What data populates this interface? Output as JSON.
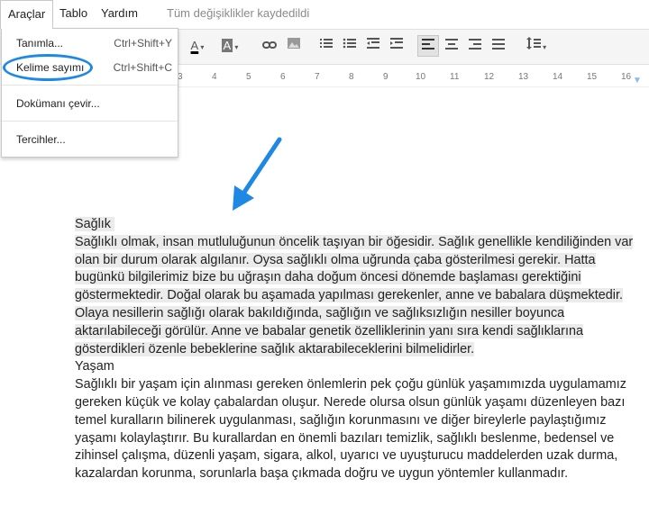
{
  "menubar": {
    "items": [
      "Araçlar",
      "Tablo",
      "Yardım"
    ],
    "status": "Tüm değişiklikler kaydedildi"
  },
  "dropdown": {
    "items": [
      {
        "label": "Tanımla...",
        "shortcut": "Ctrl+Shift+Y"
      },
      {
        "label": "Kelime sayımı",
        "shortcut": "Ctrl+Shift+C"
      },
      {
        "label": "Dokümanı çevir...",
        "shortcut": ""
      },
      {
        "label": "Tercihler...",
        "shortcut": ""
      }
    ]
  },
  "ruler": {
    "numbers": [
      "3",
      "4",
      "5",
      "6",
      "7",
      "8",
      "9",
      "10",
      "11",
      "12",
      "13",
      "14",
      "15",
      "16"
    ]
  },
  "toolbar": {
    "text_color_glyph": "A",
    "highlight_glyph": "A"
  },
  "document": {
    "heading1": "Sağlık",
    "para1": "Sağlıklı olmak, insan mutluluğunun öncelik taşıyan bir öğesidir. Sağlık genellikle kendiliğinden var olan bir durum olarak algılanır. Oysa sağlıklı olma uğrunda çaba gösterilmesi gerekir. Hatta bugünkü bilgilerimiz bize bu uğraşın daha doğum öncesi dönemde başlaması gerektiğini göstermektedir. Doğal olarak bu aşamada yapılması gerekenler, anne ve babalara düşmektedir. Olaya nesillerin sağlığı olarak bakıldığında, sağlığın ve sağlıksızlığın nesiller boyunca aktarılabileceği görülür. Anne ve babalar genetik özelliklerinin yanı sıra kendi sağlıklarına gösterdikleri özenle bebeklerine sağlık aktarabileceklerini bilmelidirler.",
    "heading2": "Yaşam",
    "para2": "Sağlıklı bir yaşam için alınması gereken önlemlerin pek çoğu günlük yaşamımızda  uygulamamız gereken küçük ve kolay çabalardan oluşur. Nerede olursa olsun günlük yaşamı düzenleyen bazı temel kuralların bilinerek uygulanması, sağlığın korunmasını ve diğer bireylerle paylaştığımız yaşamı kolaylaştırır. Bu kurallardan en önemli bazıları temizlik, sağlıklı beslenme, bedensel ve zihinsel çalışma, düzenli yaşam, sigara, alkol, uyarıcı ve uyuşturucu maddelerden uzak durma, kazalardan korunma, sorunlarla başa çıkmada doğru ve uygun yöntemler kullanmadır."
  },
  "colors": {
    "annotation": "#1e88e5",
    "selection": "#ebebeb"
  }
}
